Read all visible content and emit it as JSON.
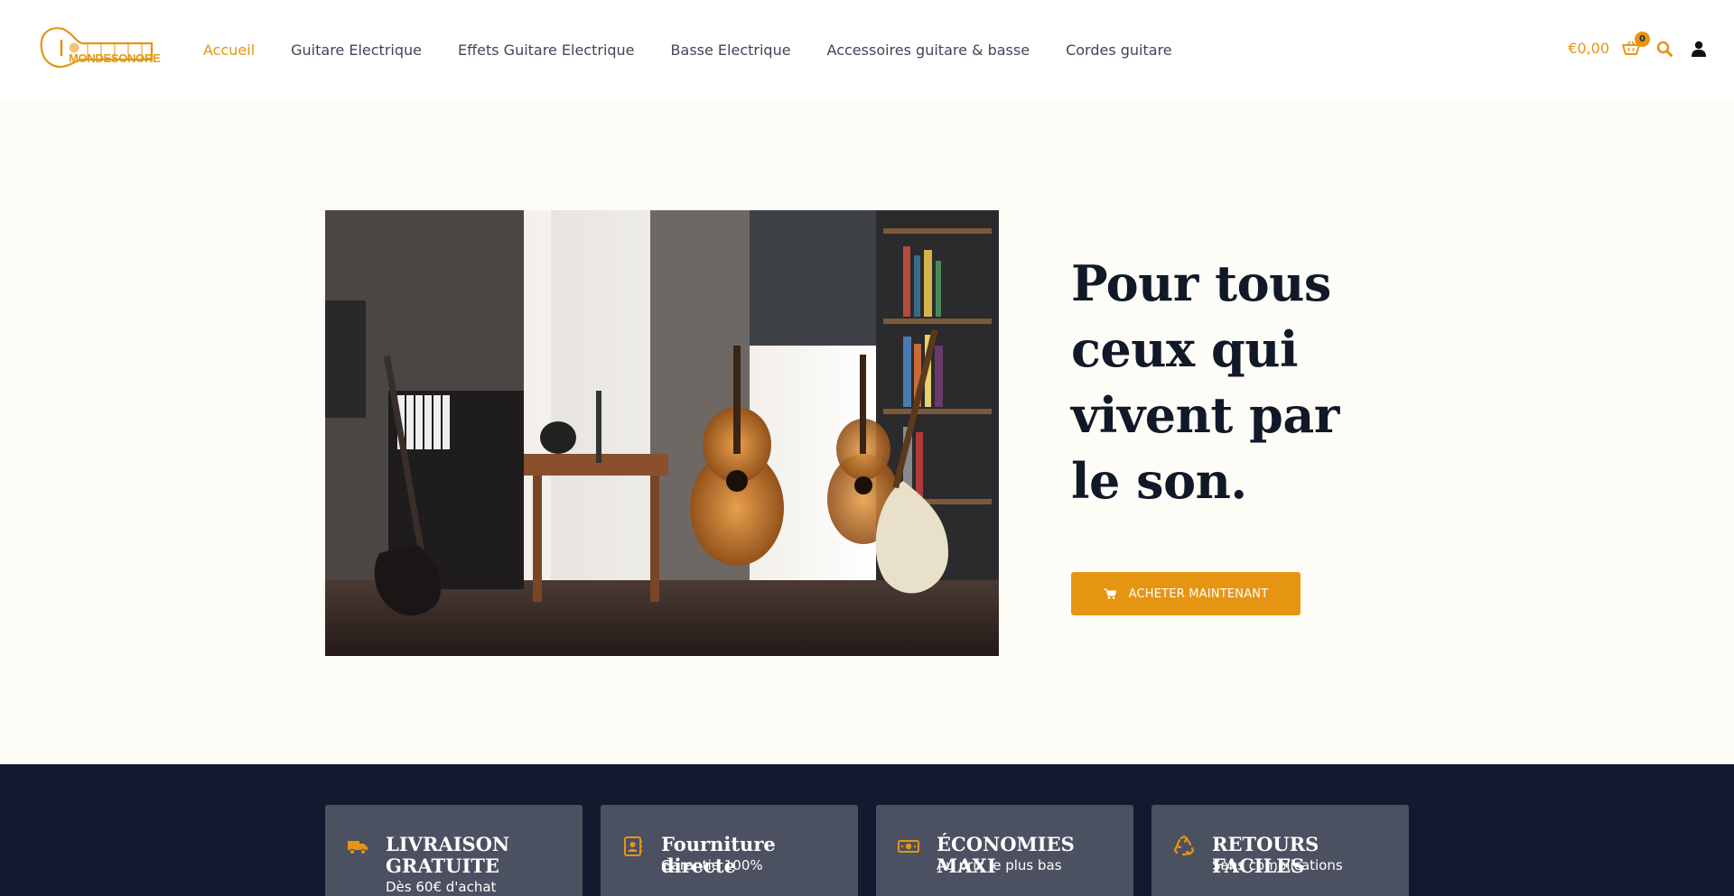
{
  "brand": {
    "logo_text": "MONDESONORE",
    "accent": "#e69512"
  },
  "nav": {
    "items": [
      {
        "label": "Accueil",
        "active": true
      },
      {
        "label": "Guitare Electrique"
      },
      {
        "label": "Effets Guitare Electrique"
      },
      {
        "label": "Basse Electrique"
      },
      {
        "label": "Accessoires guitare & basse"
      },
      {
        "label": "Cordes guitare"
      }
    ]
  },
  "header": {
    "cart_total": "€0,00",
    "cart_count": "0",
    "icons": [
      "cart-icon",
      "search-icon",
      "user-icon"
    ]
  },
  "hero": {
    "title": "Pour tous ceux qui vivent par le son.",
    "cta_label": "ACHETER MAINTENANT",
    "cta_icon": "cart-icon"
  },
  "features": [
    {
      "icon": "truck-icon",
      "title": "LIVRAISON GRATUITE",
      "subtitle": "Dès 60€ d'achat"
    },
    {
      "icon": "address-book-icon",
      "title": "Fourniture directe",
      "subtitle": "Garantie 100%"
    },
    {
      "icon": "money-bill-icon",
      "title": "ÉCONOMIES MAXI",
      "subtitle": "Au prix le plus bas"
    },
    {
      "icon": "recycle-icon",
      "title": "RETOURS FACILES",
      "subtitle": "Sans complications"
    }
  ]
}
